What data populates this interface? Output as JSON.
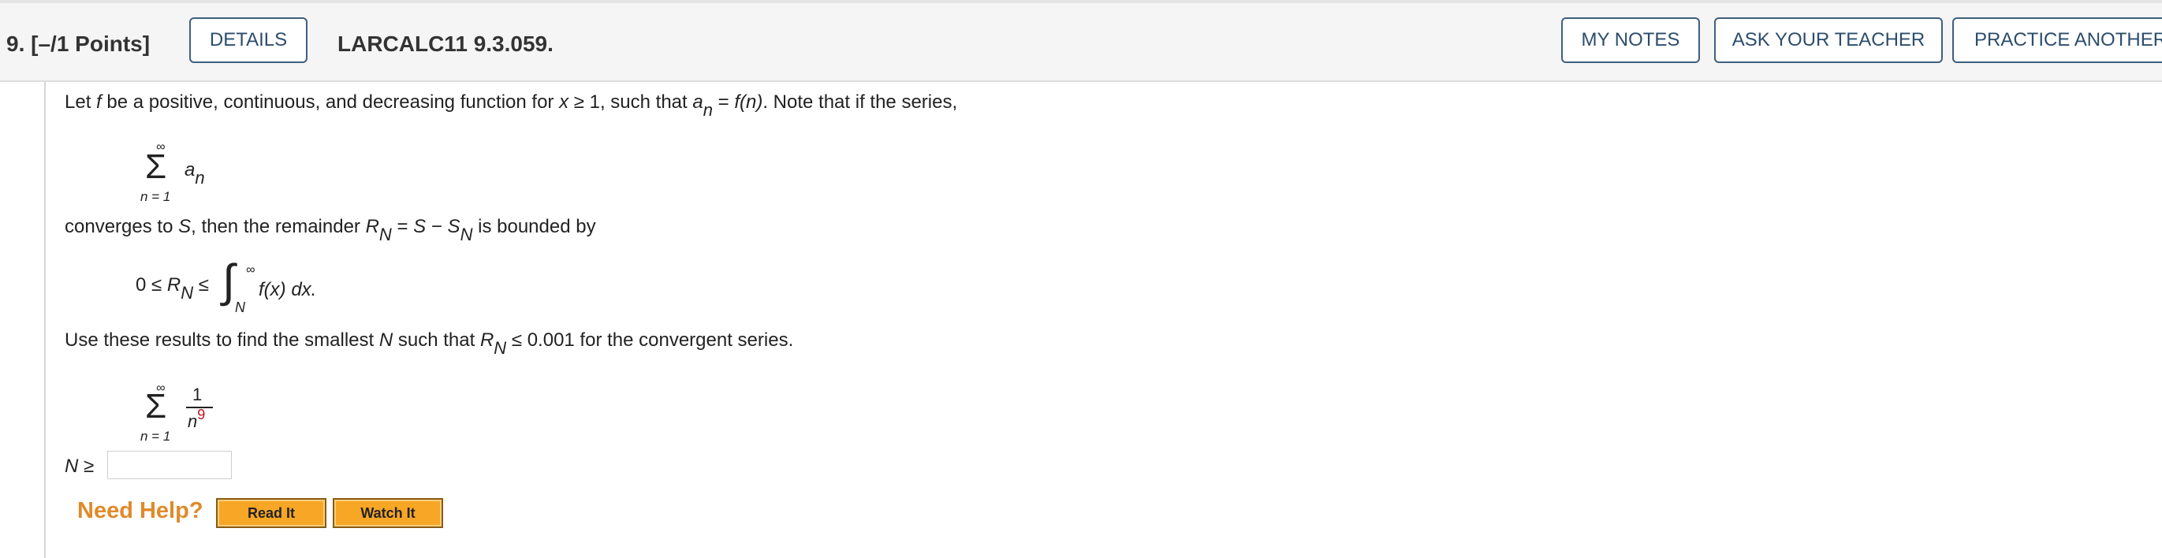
{
  "header": {
    "question_number": "9.",
    "points": "[–/1 Points]",
    "details_button": "DETAILS",
    "problem_code": "LARCALC11 9.3.059.",
    "my_notes_button": "MY NOTES",
    "ask_teacher_button": "ASK YOUR TEACHER",
    "practice_button": "PRACTICE ANOTHER"
  },
  "problem": {
    "intro_1": "Let",
    "f": "f",
    "intro_2": "be a positive, continuous, and decreasing function for",
    "x": "x",
    "intro_3": "≥ 1, such that",
    "a": "a",
    "n": "n",
    "intro_4": "=",
    "fn": "f(n)",
    "intro_5": ". Note that if the series,",
    "series1": {
      "sigma": "Σ",
      "top": "∞",
      "bottom": "n = 1",
      "term": "a",
      "term_sub": "n"
    },
    "line2_1": "converges to",
    "S": "S",
    "line2_2": ", then the remainder",
    "R": "R",
    "N": "N",
    "line2_3": "=",
    "S2": "S",
    "minus": "−",
    "S3": "S",
    "line2_4": "is bounded by",
    "bound_left": "0 ≤",
    "bound_R": "R",
    "bound_N": "N",
    "bound_le": "≤",
    "integral": "∫",
    "integral_top": "∞",
    "integral_bottom": "N",
    "integrand": "f(x) dx.",
    "line3_1": "Use these results to find the smallest",
    "line3_N": "N",
    "line3_2": "such that",
    "line3_R": "R",
    "line3_sub": "N",
    "line3_3": "≤ 0.001 for the convergent series.",
    "series2": {
      "sigma": "Σ",
      "top": "∞",
      "bottom": "n = 1",
      "numerator": "1",
      "denominator_base": "n",
      "denominator_exp": "9"
    },
    "answer_label_N": "N",
    "answer_label_ge": "≥",
    "answer_value": ""
  },
  "help": {
    "label": "Need Help?",
    "read_button": "Read It",
    "watch_button": "Watch It"
  },
  "colors": {
    "accent": "#2c4d6d",
    "need_help": "#e08a2a",
    "help_button": "#f7a625",
    "exponent_red": "#c0141a"
  }
}
